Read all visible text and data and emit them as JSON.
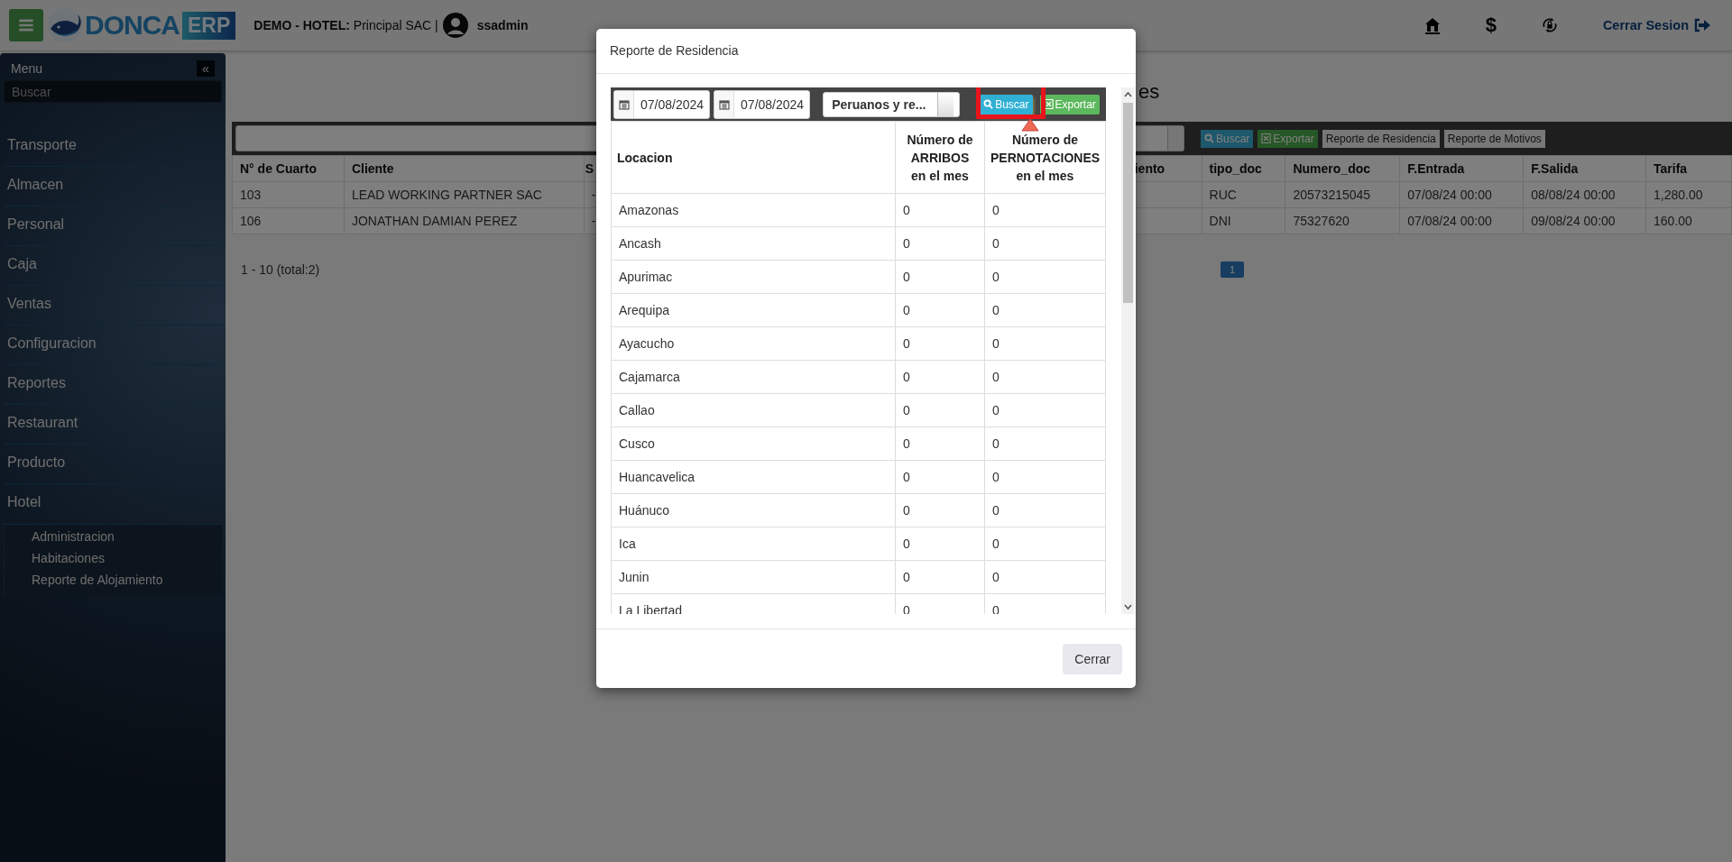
{
  "topbar": {
    "brand": "DONCA",
    "brand_badge": "ERP",
    "company_label": "DEMO - HOTEL:",
    "company": "Principal SAC |",
    "user": "ssadmin",
    "currency_icon": "$",
    "logout": "Cerrar Sesion"
  },
  "sidebar": {
    "title": "Menu",
    "collapse_icon": "«",
    "placeholder": "Buscar",
    "items": [
      {
        "label": "Transporte",
        "expanded": false
      },
      {
        "label": "Almacen",
        "expanded": false
      },
      {
        "label": "Personal",
        "expanded": false
      },
      {
        "label": "Caja",
        "expanded": false
      },
      {
        "label": "Ventas",
        "expanded": false
      },
      {
        "label": "Configuracion",
        "expanded": false
      },
      {
        "label": "Reportes",
        "expanded": false
      },
      {
        "label": "Restaurant",
        "expanded": false
      },
      {
        "label": "Producto",
        "expanded": false
      },
      {
        "label": "Hotel",
        "expanded": true,
        "children": [
          {
            "label": "Administracion"
          },
          {
            "label": "Habitaciones"
          },
          {
            "label": "Reporte de Alojamiento"
          }
        ]
      }
    ]
  },
  "main": {
    "title_fragment": "es",
    "toolbar": {
      "buttons": [
        {
          "label": "Buscar",
          "kind": "search"
        },
        {
          "label": "Exportar",
          "kind": "export"
        },
        {
          "label": "Reporte de Residencia",
          "kind": "plain"
        },
        {
          "label": "Reporte de Motivos",
          "kind": "plain"
        }
      ]
    },
    "table": {
      "columns": [
        "N° de Cuarto",
        "Cliente",
        "S",
        "iento",
        "tipo_doc",
        "Numero_doc",
        "F.Entrada",
        "F.Salida",
        "Tarifa"
      ],
      "rows": [
        [
          "103",
          "LEAD WORKING PARTNER SAC",
          "-",
          null,
          "RUC",
          "20573215045",
          "07/08/24 00:00",
          "08/08/24 00:00",
          "1,280.00"
        ],
        [
          "106",
          "JONATHAN DAMIAN PEREZ",
          "-",
          null,
          "DNI",
          "75327620",
          "07/08/24 00:00",
          "09/08/24 00:00",
          "160.00"
        ]
      ]
    },
    "pagination": {
      "summary": "1 - 10 (total:2)",
      "pages": [
        {
          "label": "1",
          "selected": true
        }
      ]
    }
  },
  "modal": {
    "title": "Reporte de Residencia",
    "date_from": "07/08/2024",
    "date_to": "07/08/2024",
    "filter": "Peruanos y re...",
    "buttons": [
      {
        "label": "Buscar",
        "kind": "search",
        "highlighted": true
      },
      {
        "label": "Exportar",
        "kind": "export",
        "highlighted": false
      }
    ],
    "table": {
      "columns": [
        "Locacion",
        "Número de ARRIBOS en el mes",
        "Número de PERNOTACIONES en el mes"
      ],
      "rows": [
        [
          "Amazonas",
          "0",
          "0"
        ],
        [
          "Ancash",
          "0",
          "0"
        ],
        [
          "Apurimac",
          "0",
          "0"
        ],
        [
          "Arequipa",
          "0",
          "0"
        ],
        [
          "Ayacucho",
          "0",
          "0"
        ],
        [
          "Cajamarca",
          "0",
          "0"
        ],
        [
          "Callao",
          "0",
          "0"
        ],
        [
          "Cusco",
          "0",
          "0"
        ],
        [
          "Huancavelica",
          "0",
          "0"
        ],
        [
          "Huánuco",
          "0",
          "0"
        ],
        [
          "Ica",
          "0",
          "0"
        ],
        [
          "Junin",
          "0",
          "0"
        ],
        [
          "La Libertad",
          "0",
          "0"
        ]
      ]
    },
    "close_button": "Cerrar"
  }
}
